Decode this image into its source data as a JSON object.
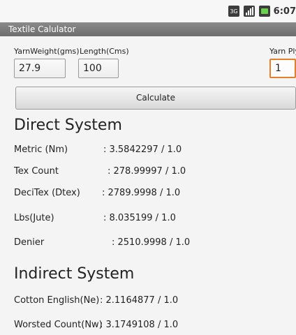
{
  "status_bar": {
    "time": "6:07",
    "icons": [
      "network-3g-icon",
      "signal-bars-icon",
      "battery-icon"
    ]
  },
  "app": {
    "title": "Textile Calulator"
  },
  "form": {
    "yarn_weight": {
      "label": "YarnWeight(gms)",
      "value": "27.9"
    },
    "length": {
      "label": "Length(Cms)",
      "value": "100"
    },
    "yarn_ply": {
      "label": "Yarn Ply",
      "value": "1"
    },
    "calculate_label": "Calculate"
  },
  "direct_system": {
    "title": "Direct System",
    "rows": [
      {
        "label": "Metric (Nm)",
        "value": ": 3.5842297 / 1.0"
      },
      {
        "label": "Tex Count",
        "value": ": 278.99997 / 1.0"
      },
      {
        "label": "DeciTex (Dtex)",
        "value": ": 2789.9998 / 1.0"
      },
      {
        "label": "Lbs(Jute)",
        "value": ": 8.035199 / 1.0"
      },
      {
        "label": "Denier",
        "value": ": 2510.9998 / 1.0"
      }
    ]
  },
  "indirect_system": {
    "title": "Indirect System",
    "rows": [
      {
        "label": "Cotton English(Ne)",
        "value": ": 2.1164877 / 1.0"
      },
      {
        "label": "Worsted Count(Nw)",
        "value": ": 3.1749108 / 1.0"
      }
    ]
  }
}
